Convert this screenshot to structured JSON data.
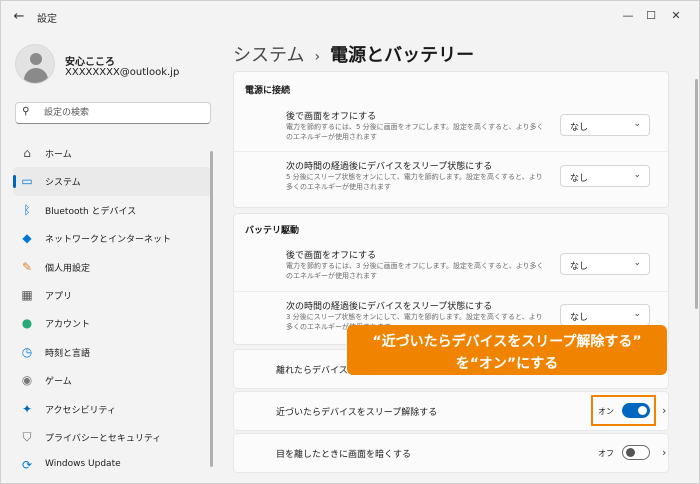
{
  "titlebar": {
    "back_icon": "arrow-left-icon",
    "title": "設定",
    "minimize": "—",
    "maximize": "☐",
    "close": "✕"
  },
  "user": {
    "name": "安心こころ",
    "email": "XXXXXXXX@outlook.jp"
  },
  "search": {
    "placeholder": "設定の検索"
  },
  "nav": {
    "items": [
      {
        "label": "ホーム",
        "icon": "home-icon",
        "glyph": "⌂",
        "color": "#555555"
      },
      {
        "label": "システム",
        "icon": "monitor-icon",
        "glyph": "▭",
        "color": "#0078d4",
        "active": true
      },
      {
        "label": "Bluetooth とデバイス",
        "icon": "bluetooth-icon",
        "glyph": "ᛒ",
        "color": "#0078d4"
      },
      {
        "label": "ネットワークとインターネット",
        "icon": "wifi-icon",
        "glyph": "◆",
        "color": "#0078d4"
      },
      {
        "label": "個人用設定",
        "icon": "brush-icon",
        "glyph": "✎",
        "color": "#d9822b"
      },
      {
        "label": "アプリ",
        "icon": "apps-icon",
        "glyph": "▦",
        "color": "#555555"
      },
      {
        "label": "アカウント",
        "icon": "account-icon",
        "glyph": "●",
        "color": "#2aa876"
      },
      {
        "label": "時刻と言語",
        "icon": "clock-globe-icon",
        "glyph": "◷",
        "color": "#0078d4"
      },
      {
        "label": "ゲーム",
        "icon": "gamepad-icon",
        "glyph": "◉",
        "color": "#777777"
      },
      {
        "label": "アクセシビリティ",
        "icon": "accessibility-icon",
        "glyph": "✦",
        "color": "#0067c0"
      },
      {
        "label": "プライバシーとセキュリティ",
        "icon": "shield-icon",
        "glyph": "⛉",
        "color": "#6a6a6a"
      },
      {
        "label": "Windows Update",
        "icon": "update-icon",
        "glyph": "⟳",
        "color": "#0078d4"
      }
    ]
  },
  "header": {
    "parent": "システム",
    "separator": "›",
    "current": "電源とバッテリー"
  },
  "ac": {
    "title": "電源に接続",
    "rows": [
      {
        "title": "後で画面をオフにする",
        "desc": "電力を節約するには、5 分後に画面をオフにします。設定を高くすると、より多くのエネルギーが使用されます",
        "value": "なし"
      },
      {
        "title": "次の時間の経過後にデバイスをスリープ状態にする",
        "desc": "5 分後にスリープ状態をオンにして、電力を節約します。設定を高くすると、より多くのエネルギーが使用されます",
        "value": "なし"
      }
    ]
  },
  "battery": {
    "title": "バッテリ駆動",
    "rows": [
      {
        "title": "後で画面をオフにする",
        "desc": "電力を節約するには、3 分後に画面をオフにします。設定を高くすると、より多くのエネルギーが使用されます",
        "value": "なし"
      },
      {
        "title": "次の時間の経過後にデバイスをスリープ状態にする",
        "desc": "3 分後にスリープ状態をオンにして、電力を節約します。設定を高くすると、より多くのエネルギーが使用されます",
        "value": "なし"
      }
    ]
  },
  "toggles": [
    {
      "title": "離れたらデバイスのロックを解除する",
      "state": "",
      "on": null
    },
    {
      "title": "近づいたらデバイスをスリープ解除する",
      "state": "オン",
      "on": true
    },
    {
      "title": "目を離したときに画面を暗くする",
      "state": "オフ",
      "on": false
    }
  ],
  "callout": {
    "line1": "“近づいたらデバイスをスリープ解除する”",
    "line2": "を“オン”にする",
    "color": "#f08300"
  },
  "accent": "#0067c0"
}
